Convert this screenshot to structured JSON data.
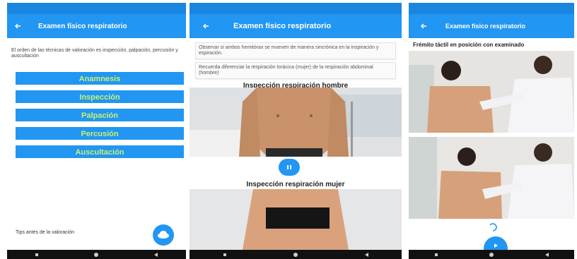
{
  "screens": [
    {
      "title": "Examen físico respiratorio",
      "description": "El orden de las técnicas de valoración es inspección, palpación, percusión y auscultación",
      "menu": [
        "Anamnesis",
        "Inspección",
        "Palpación",
        "Percusión",
        "Auscultación"
      ],
      "tips_label": "Tips antes de la valoración"
    },
    {
      "title": "Examen físico respiratorio",
      "note1": "Observar si ambos hemitórax se mueven de manera sincrónica en la inspiración y espiración.",
      "note2": "Recuerda diferenciar la respiración torácica (mujer) de la respiración abdominal (hombre)",
      "video1_title": "Inspección respiración hombre",
      "video2_title": "Inspección respiración mujer"
    },
    {
      "title": "Examen físico respiratorio",
      "heading": "Frémito táctil en posición con examinado"
    }
  ],
  "colors": {
    "primary": "#2196f3",
    "status": "#1a86e0",
    "menu_text": "#c9f26a"
  },
  "icons": [
    "back-arrow-icon",
    "pause-icon",
    "play-icon",
    "cloud-icon"
  ]
}
